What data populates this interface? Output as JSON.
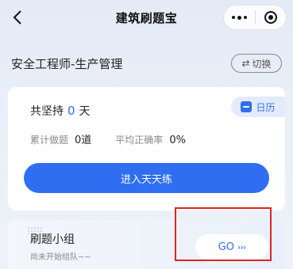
{
  "navbar": {
    "title": "建筑刷题宝",
    "back_icon": "back-chevron-icon",
    "more_icon": "more-dots-icon",
    "target_icon": "target-icon"
  },
  "subject": {
    "name": "安全工程师-生产管理",
    "switch_label": "切换",
    "switch_icon": "⇄"
  },
  "stats_card": {
    "streak_prefix": "共坚持",
    "streak_days": "0",
    "streak_suffix": "天",
    "calendar_label": "日历",
    "total_label": "累计做题",
    "total_value": "0道",
    "accuracy_label": "平均正确率",
    "accuracy_value": "0%",
    "practice_button": "进入天天练"
  },
  "group": {
    "title": "刷题小组",
    "subtitle": "尚未开始组队~~",
    "go_label": "GO",
    "go_arrows": "›››"
  },
  "colors": {
    "accent": "#2f6ef0",
    "highlight": "#e02424",
    "background": "#e8eef8"
  }
}
